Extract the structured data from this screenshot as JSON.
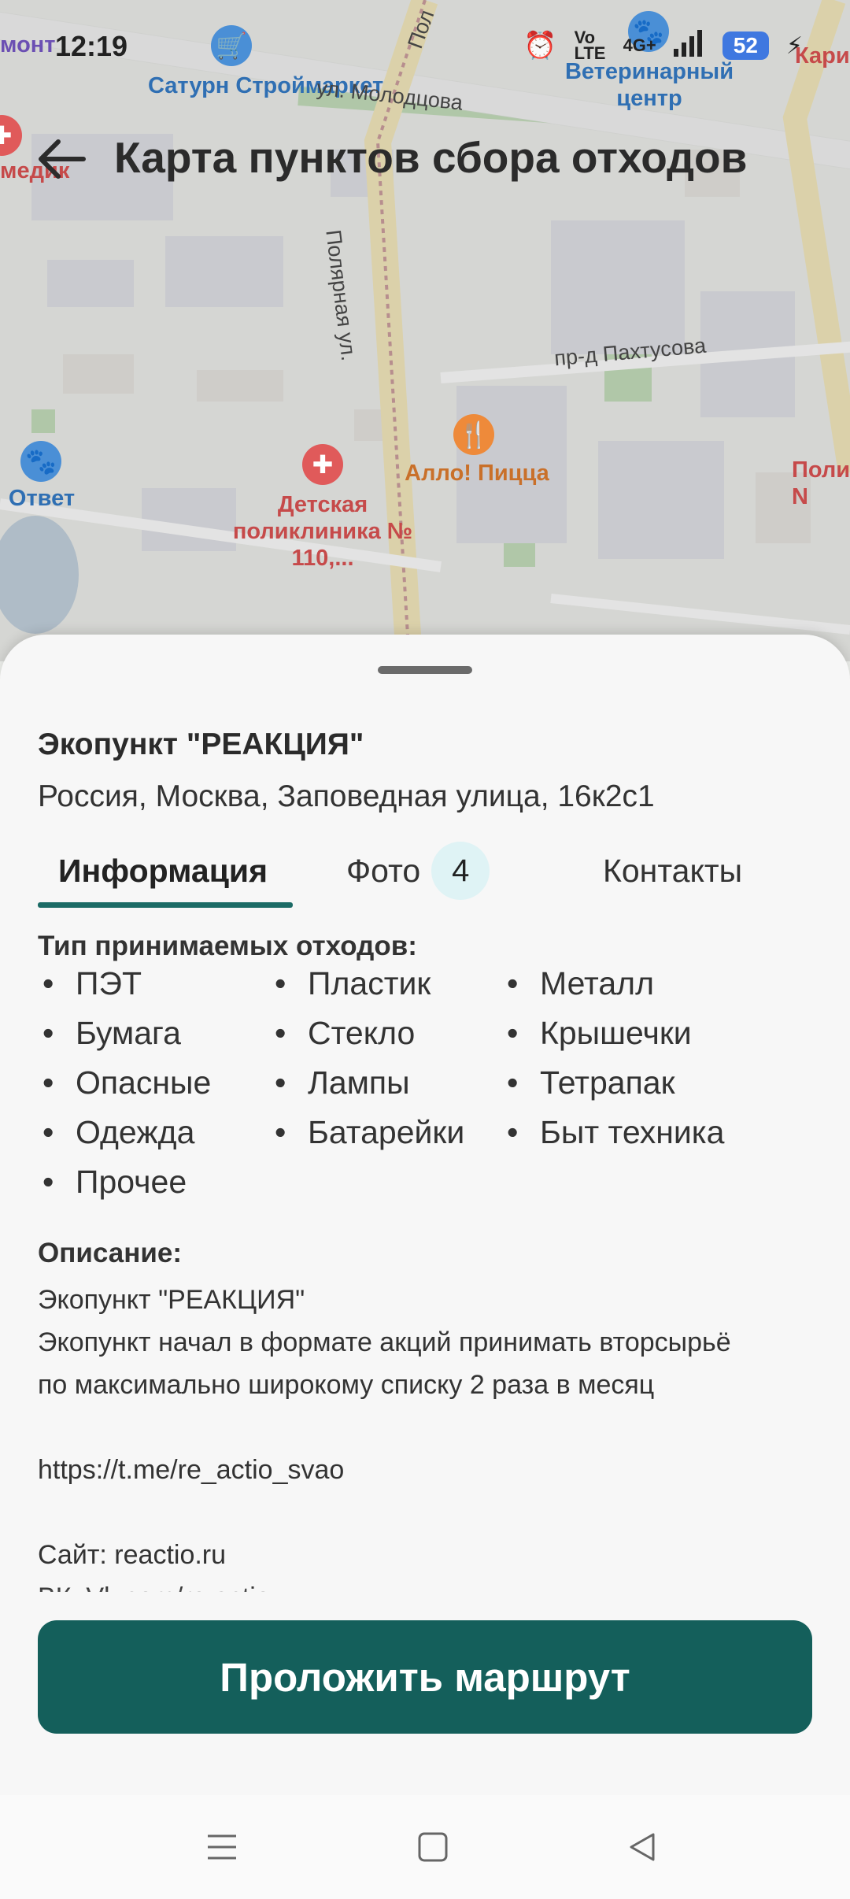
{
  "status_bar": {
    "time": "12:19",
    "network": "4G+",
    "volte": "Vo LTE",
    "battery": "52"
  },
  "header": {
    "title": "Карта пунктов сбора отходов"
  },
  "map": {
    "streets": {
      "molodtsova": "ул. Молодцова",
      "pakhtusova": "пр-д Пахтусова",
      "polyarnaya": "Полярная ул.",
      "pol_top": "Пол"
    },
    "pois": {
      "saturn": "Сатурн Строймаркет",
      "vet": "Ветеринарный центр",
      "pizza": "Алло! Пицца",
      "clinic": "Детская поликлиника № 110,...",
      "otvet": "Ответ",
      "medik": "медик",
      "remont": "монт",
      "kari": "Кари",
      "poli": "Поли N"
    }
  },
  "sheet": {
    "place_name": "Экопункт \"РЕАКЦИЯ\"",
    "address": "Россия, Москва, Заповедная улица, 16к2с1",
    "tabs": {
      "info": "Информация",
      "photo": "Фото",
      "photo_count": "4",
      "contacts": "Контакты"
    },
    "waste_title": "Тип принимаемых отходов:",
    "waste_types": [
      "ПЭТ",
      "Пластик",
      "Металл",
      "Бумага",
      "Стекло",
      "Крышечки",
      "Опасные",
      "Лампы",
      "Тетрапак",
      "Одежда",
      "Батарейки",
      "Быт техника",
      "Прочее"
    ],
    "description_title": "Описание:",
    "description_lines": [
      "Экопункт \"РЕАКЦИЯ\"",
      "Экопункт начал в формате акций принимать вторсырьё",
      "по максимально широкому списку 2 раза в месяц",
      "https://t.me/re_actio_svao",
      "Сайт: reactio.ru",
      "ВК: Vk.com/re actio"
    ],
    "route_button": "Проложить маршрут"
  },
  "colors": {
    "accent": "#145f5b",
    "tab_underline": "#1c6b66",
    "badge_bg": "#dff3f5"
  }
}
